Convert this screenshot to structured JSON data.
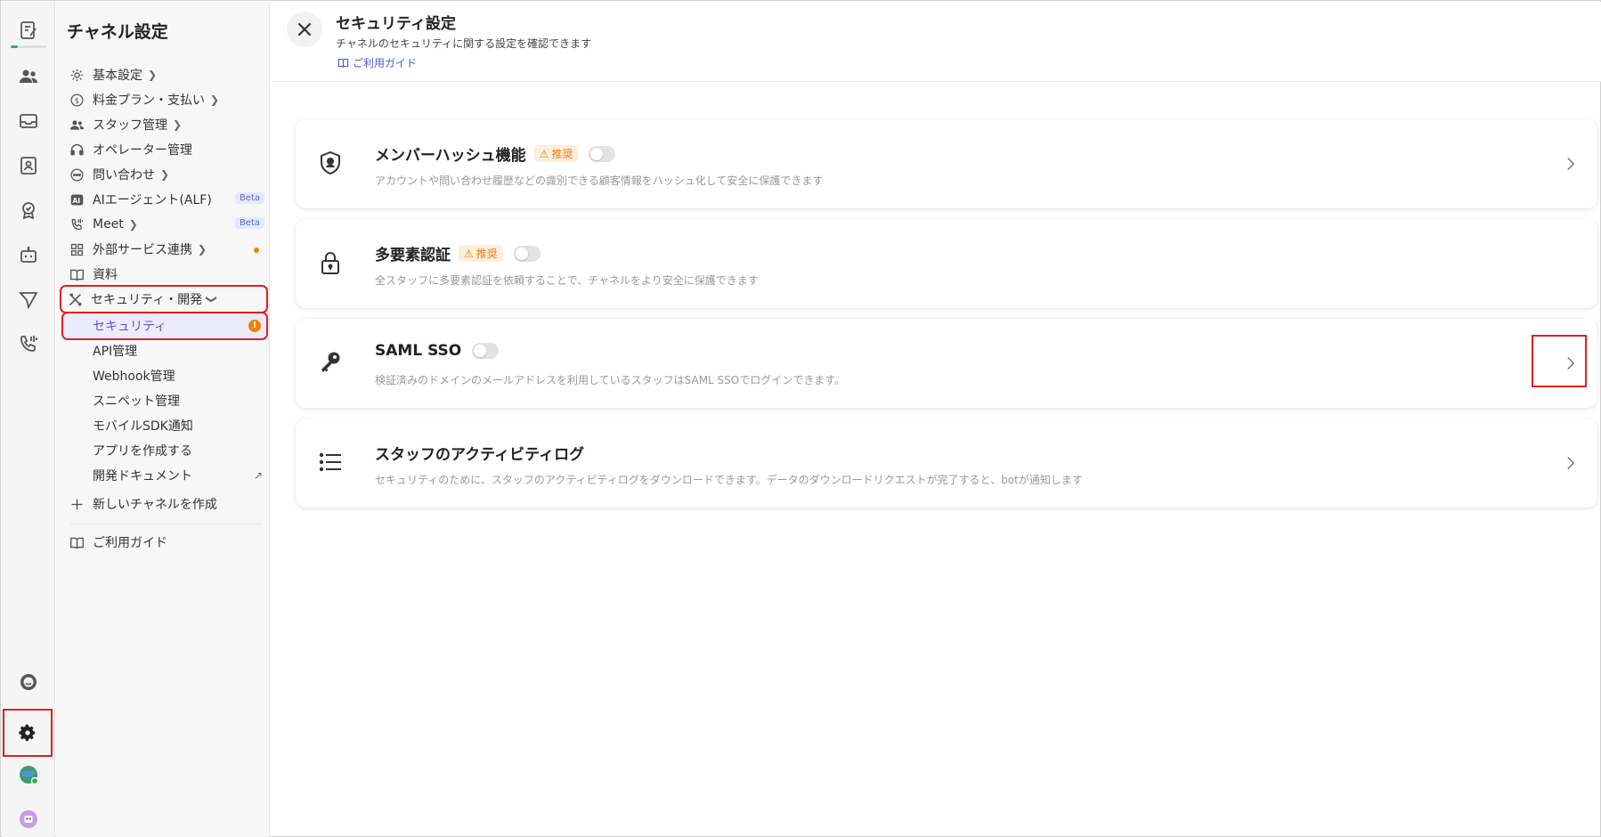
{
  "sidebar": {
    "title": "チャネル設定",
    "items": [
      {
        "label": "基本設定",
        "icon": "gear-icon"
      },
      {
        "label": "料金プラン・支払い",
        "icon": "dollar-icon"
      },
      {
        "label": "スタッフ管理",
        "icon": "users-icon"
      },
      {
        "label": "オペレーター管理",
        "icon": "headset-icon"
      },
      {
        "label": "問い合わせ",
        "icon": "chat-icon"
      },
      {
        "label": "AIエージェント(ALF)",
        "icon": "ai-icon",
        "badge": "Beta"
      },
      {
        "label": "Meet",
        "icon": "phone-icon",
        "badge": "Beta"
      },
      {
        "label": "外部サービス連携",
        "icon": "grid-icon"
      },
      {
        "label": "資料",
        "icon": "book-icon"
      },
      {
        "label": "セキュリティ・開発",
        "icon": "tools-icon"
      }
    ],
    "subitems": [
      {
        "label": "セキュリティ"
      },
      {
        "label": "API管理"
      },
      {
        "label": "Webhook管理"
      },
      {
        "label": "スニペット管理"
      },
      {
        "label": "モバイルSDK通知"
      },
      {
        "label": "アプリを作成する"
      },
      {
        "label": "開発ドキュメント"
      }
    ],
    "new_channel": "新しいチャネルを作成",
    "guide": "ご利用ガイド"
  },
  "header": {
    "title": "セキュリティ設定",
    "subtitle": "チャネルのセキュリティに関する設定を確認できます",
    "guide_link": "ご利用ガイド"
  },
  "cards": [
    {
      "title": "メンバーハッシュ機能",
      "badge": "推奨",
      "toggle": false,
      "description": "アカウントや問い合わせ履歴などの識別できる顧客情報をハッシュ化して安全に保護できます"
    },
    {
      "title": "多要素認証",
      "badge": "推奨",
      "toggle": false,
      "description": "全スタッフに多要素認証を依頼することで、チャネルをより安全に保護できます"
    },
    {
      "title": "SAML SSO",
      "toggle": false,
      "description": "検証済みのドメインのメールアドレスを利用しているスタッフはSAML SSOでログインできます。"
    },
    {
      "title": "スタッフのアクティビティログ",
      "description": "セキュリティのために、スタッフのアクティビティログをダウンロードできます。データのダウンロードリクエストが完了すると、botが通知します"
    }
  ],
  "colors": {
    "accent": "#5656d6",
    "warning": "#f08000",
    "highlight": "#e02020"
  }
}
